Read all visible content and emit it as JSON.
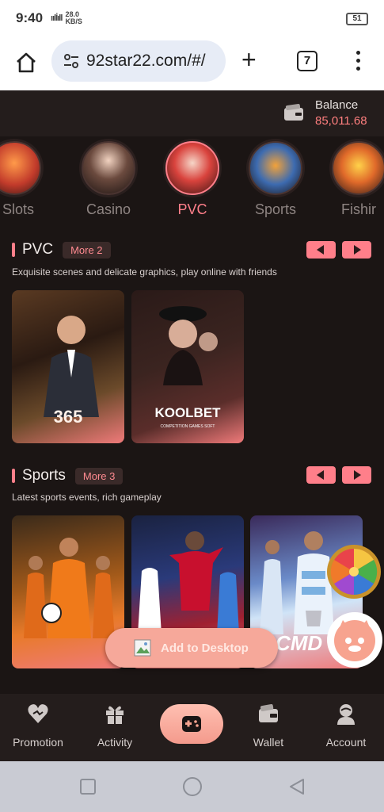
{
  "status_bar": {
    "time": "9:40",
    "signal": "ıılİıll",
    "net_speed": "28.0",
    "net_unit": "KB/S",
    "battery": "51"
  },
  "browser": {
    "url": "92star22.com/#/",
    "tab_count": "7"
  },
  "balance": {
    "label": "Balance",
    "value": "85,011.68"
  },
  "categories": [
    {
      "label": "t Slots"
    },
    {
      "label": "Casino"
    },
    {
      "label": "PVC",
      "active": true
    },
    {
      "label": "Sports"
    },
    {
      "label": "Fishir"
    }
  ],
  "sections": {
    "pvc": {
      "title": "PVC",
      "more": "More 2",
      "description": "Exquisite scenes and delicate graphics, play online with friends",
      "cards": [
        {
          "brand": "365"
        },
        {
          "brand": "KOOLBET",
          "sub": "COMPETITION GAMES SOFT"
        }
      ]
    },
    "sports": {
      "title": "Sports",
      "more": "More 3",
      "description": "Latest sports events, rich gameplay",
      "cards": [
        {
          "brand": ""
        },
        {
          "brand": ""
        },
        {
          "brand": "CMD"
        }
      ]
    }
  },
  "add_to_desktop": "Add to Desktop",
  "bottom_nav": [
    {
      "label": "Promotion"
    },
    {
      "label": "Activity"
    },
    {
      "label": "Wallet"
    },
    {
      "label": "Account"
    }
  ],
  "colors": {
    "accent": "#ff7f8a",
    "background": "#1b1514",
    "balance": "#ff7f7f"
  }
}
